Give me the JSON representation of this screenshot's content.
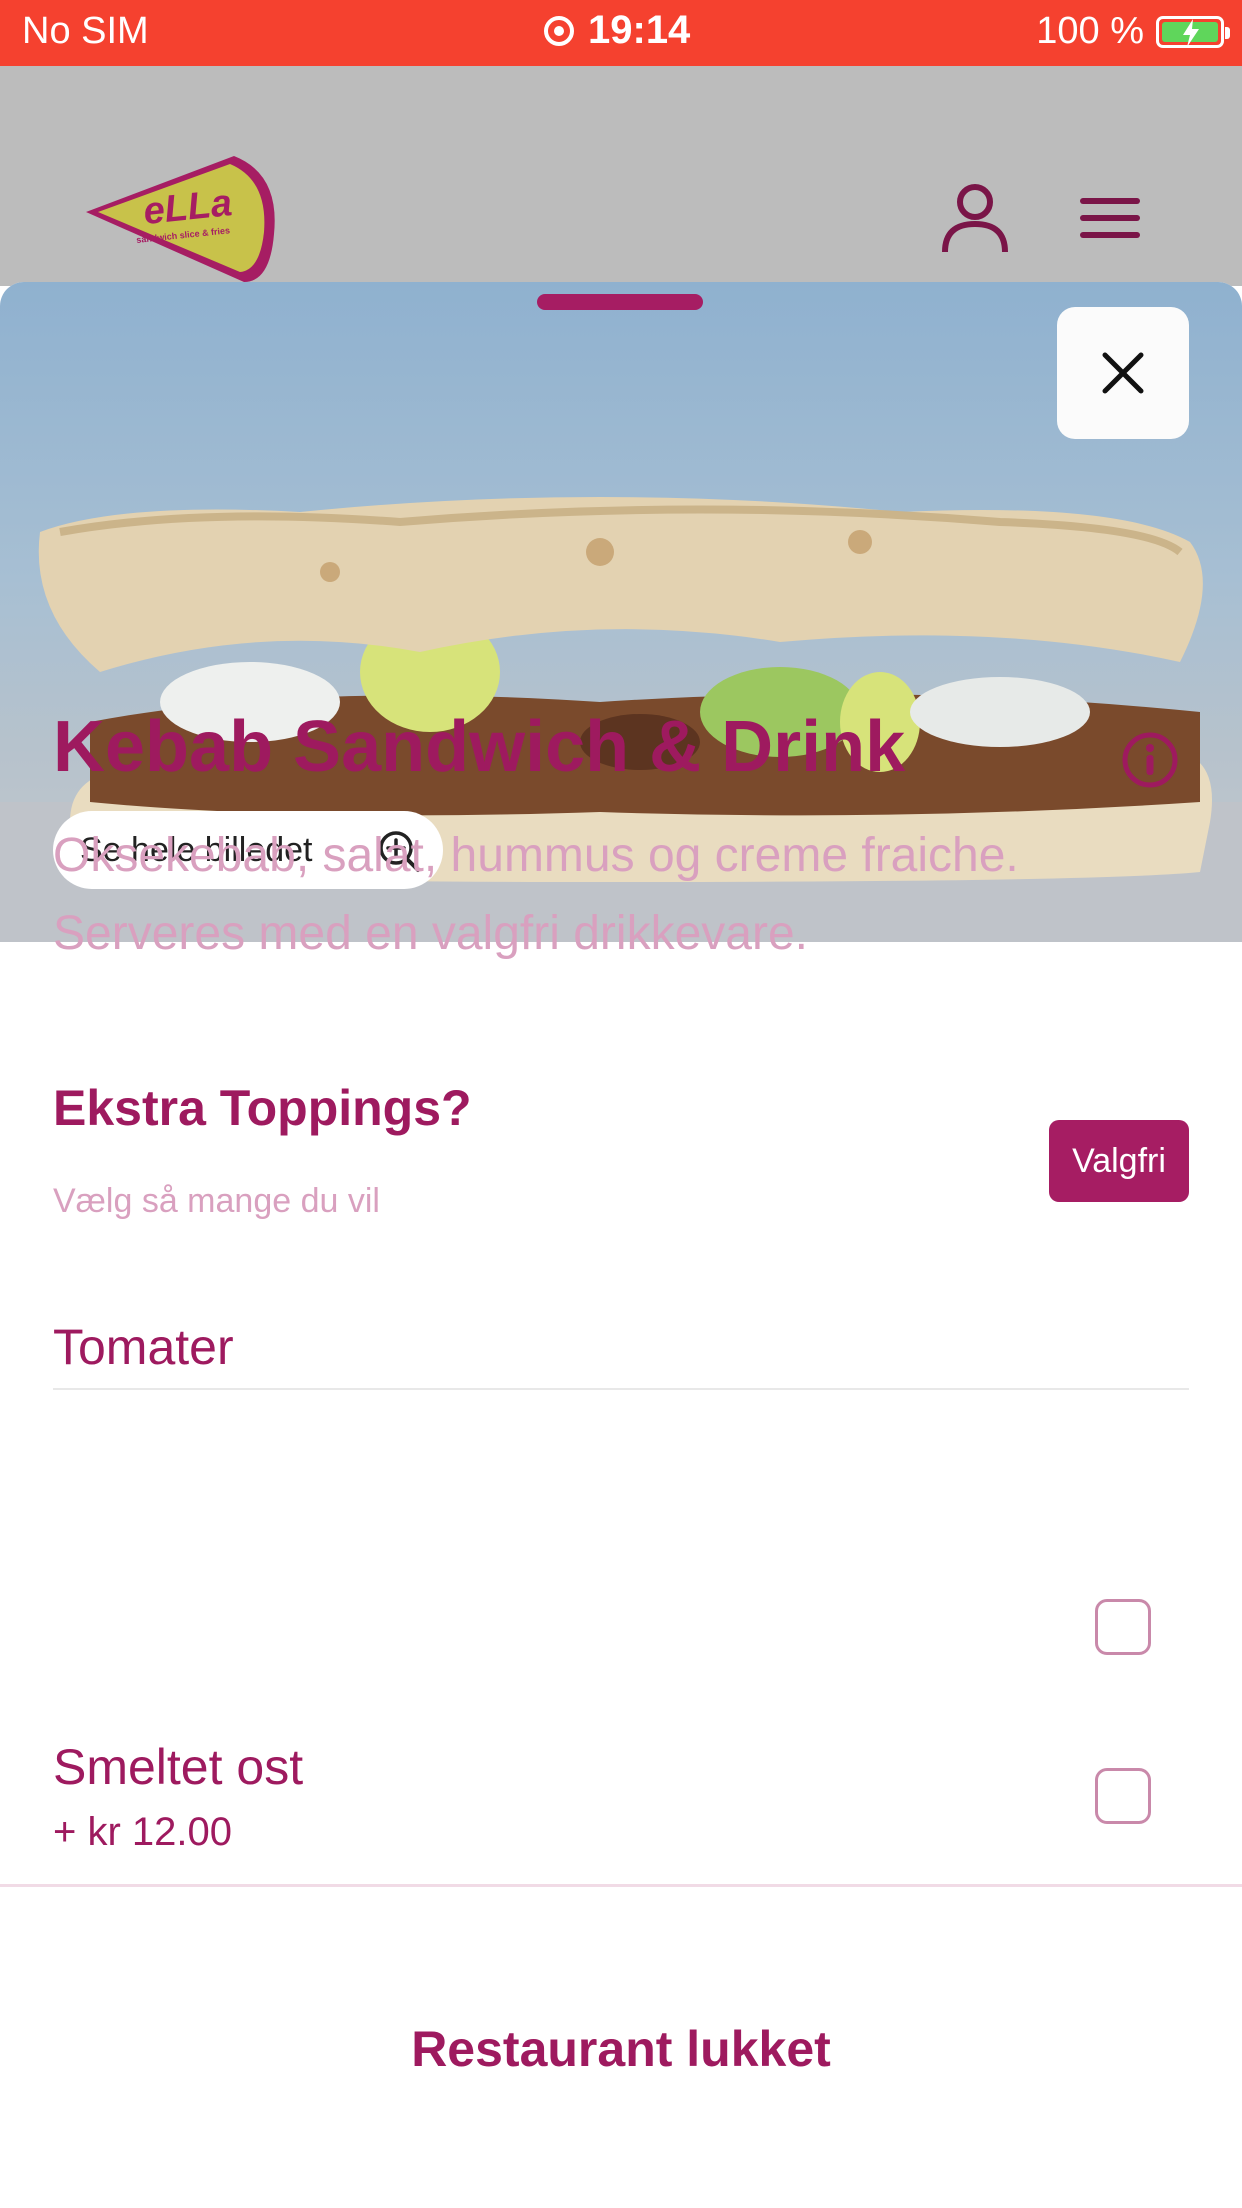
{
  "status_bar": {
    "carrier": "No SIM",
    "time": "19:14",
    "battery": "100 %",
    "colors": {
      "background": "#f5412f",
      "battery_fill": "#5fd65b"
    }
  },
  "header": {
    "logo_text": "eLLa",
    "logo_tagline": "sandwich slice & fries",
    "icons": [
      "user-icon",
      "menu-icon"
    ]
  },
  "modal": {
    "zoom_label": "Se hele billedet",
    "product": {
      "title": "Kebab Sandwich & Drink",
      "description": "Oksekebab, salat, hummus og creme fraiche. Serveres med en valgfri drikkevare."
    },
    "toppings": {
      "title": "Ekstra Toppings?",
      "subtitle": "Vælg så mange du vil",
      "badge": "Valgfri",
      "options": [
        {
          "label": "Tomater",
          "price": "",
          "checked": false
        },
        {
          "label": "Smeltet ost",
          "price": "+ kr 12.00",
          "checked": false
        }
      ]
    },
    "footer_status": "Restaurant lukket"
  },
  "colors": {
    "brand": "#9e1a5f",
    "brand_light": "#d9a0bf",
    "overlay": "#bcbcbc"
  }
}
